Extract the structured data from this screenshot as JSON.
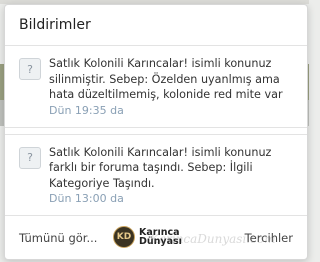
{
  "popup": {
    "title": "Bildirimler"
  },
  "notifications": [
    {
      "icon": "question-icon",
      "icon_glyph": "?",
      "text": "Satlık Kolonili Karıncalar! isimli konunuz silinmiştir. Sebep: Özelden uyanlmış ama hata düzeltilmemiş, kolonide red mite var",
      "time": "Dün 19:35 da"
    },
    {
      "icon": "question-icon",
      "icon_glyph": "?",
      "text": "Satlık Kolonili Karıncalar! isimli konunuz farklı bir foruma taşındı. Sebep: İlgili Kategoriye Taşındı.",
      "time": "Dün 13:00 da"
    }
  ],
  "footer": {
    "see_all": "Tümünü gör...",
    "preferences": "Tercihler"
  },
  "logo": {
    "badge": "KD",
    "line1": "Karınca",
    "line2": "Dünyası"
  },
  "watermark": "KarincaDunyasi.com"
}
